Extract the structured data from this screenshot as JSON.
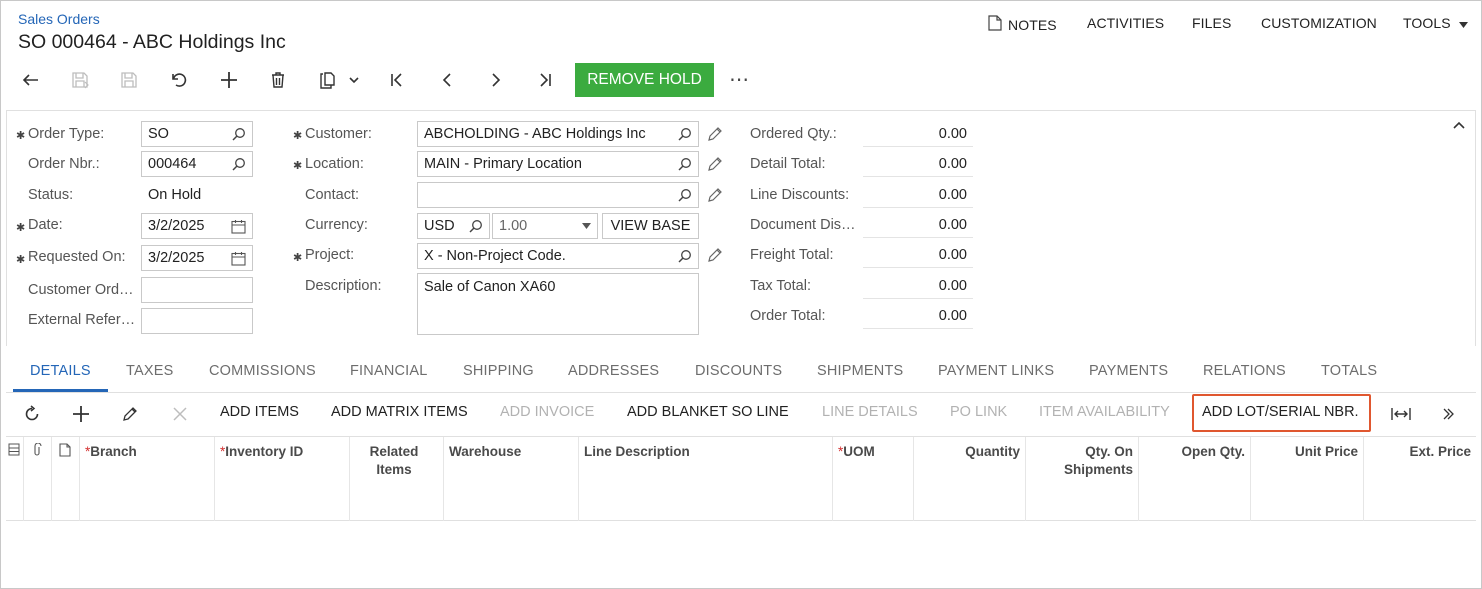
{
  "header": {
    "breadcrumb": "Sales Orders",
    "title": "SO 000464 - ABC Holdings Inc",
    "nav": {
      "notes": "NOTES",
      "activities": "ACTIVITIES",
      "files": "FILES",
      "customization": "CUSTOMIZATION",
      "tools": "TOOLS"
    }
  },
  "toolbar": {
    "remove_hold": "REMOVE HOLD",
    "more": "⋯"
  },
  "form": {
    "order_type": {
      "label": "Order Type:",
      "value": "SO"
    },
    "order_nbr": {
      "label": "Order Nbr.:",
      "value": "000464"
    },
    "status": {
      "label": "Status:",
      "value": "On Hold"
    },
    "date": {
      "label": "Date:",
      "value": "3/2/2025"
    },
    "requested_on": {
      "label": "Requested On:",
      "value": "3/2/2025"
    },
    "customer_order": {
      "label": "Customer Ord…",
      "value": ""
    },
    "external_ref": {
      "label": "External Refer…",
      "value": ""
    },
    "customer": {
      "label": "Customer:",
      "value": "ABCHOLDING - ABC Holdings Inc"
    },
    "location": {
      "label": "Location:",
      "value": "MAIN - Primary Location"
    },
    "contact": {
      "label": "Contact:",
      "value": ""
    },
    "currency": {
      "label": "Currency:",
      "value": "USD",
      "rate": "1.00",
      "view_base": "VIEW BASE"
    },
    "project": {
      "label": "Project:",
      "value": "X - Non-Project Code."
    },
    "description": {
      "label": "Description:",
      "value": "Sale of Canon XA60"
    }
  },
  "totals": [
    {
      "label": "Ordered Qty.:",
      "value": "0.00"
    },
    {
      "label": "Detail Total:",
      "value": "0.00"
    },
    {
      "label": "Line Discounts:",
      "value": "0.00"
    },
    {
      "label": "Document Dis…",
      "value": "0.00"
    },
    {
      "label": "Freight Total:",
      "value": "0.00"
    },
    {
      "label": "Tax Total:",
      "value": "0.00"
    },
    {
      "label": "Order Total:",
      "value": "0.00"
    }
  ],
  "tabs": [
    "DETAILS",
    "TAXES",
    "COMMISSIONS",
    "FINANCIAL",
    "SHIPPING",
    "ADDRESSES",
    "DISCOUNTS",
    "SHIPMENTS",
    "PAYMENT LINKS",
    "PAYMENTS",
    "RELATIONS",
    "TOTALS"
  ],
  "grid_toolbar": {
    "add_items": "ADD ITEMS",
    "add_matrix_items": "ADD MATRIX ITEMS",
    "add_invoice": "ADD INVOICE",
    "add_blanket_so_line": "ADD BLANKET SO LINE",
    "line_details": "LINE DETAILS",
    "po_link": "PO LINK",
    "item_availability": "ITEM AVAILABILITY",
    "add_lot_serial_nbr": "ADD LOT/SERIAL NBR."
  },
  "grid": {
    "columns": {
      "branch": "Branch",
      "inventory_id": "Inventory ID",
      "related_items": "Related Items",
      "warehouse": "Warehouse",
      "line_description": "Line Description",
      "uom": "UOM",
      "quantity": "Quantity",
      "qty_on_shipments": "Qty. On Shipments",
      "open_qty": "Open Qty.",
      "unit_price": "Unit Price",
      "ext_price": "Ext. Price"
    }
  },
  "colors": {
    "link": "#2466b7",
    "primary_button": "#3bab3f",
    "highlight": "#e0572f",
    "required": "#d32f2f"
  }
}
